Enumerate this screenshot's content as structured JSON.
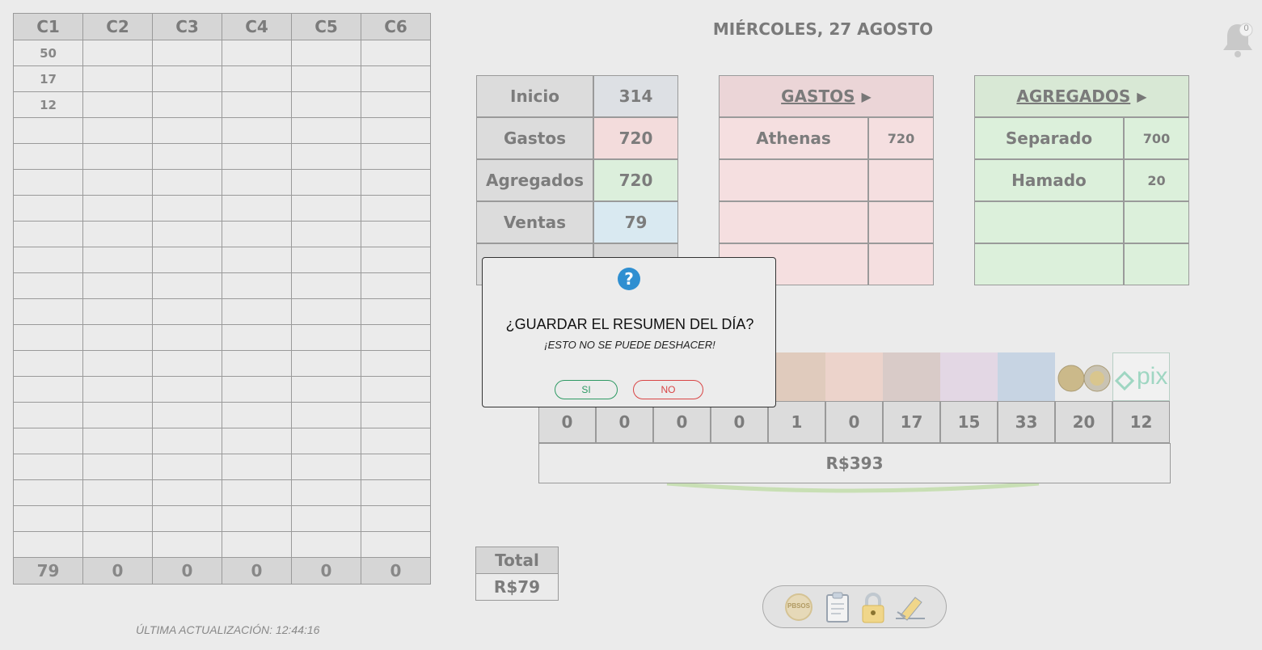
{
  "grid": {
    "headers": [
      "C1",
      "C2",
      "C3",
      "C4",
      "C5",
      "C6"
    ],
    "rows": [
      [
        "50",
        "",
        "",
        "",
        "",
        ""
      ],
      [
        "17",
        "",
        "",
        "",
        "",
        ""
      ],
      [
        "12",
        "",
        "",
        "",
        "",
        ""
      ],
      [
        "",
        "",
        "",
        "",
        "",
        ""
      ],
      [
        "",
        "",
        "",
        "",
        "",
        ""
      ],
      [
        "",
        "",
        "",
        "",
        "",
        ""
      ],
      [
        "",
        "",
        "",
        "",
        "",
        ""
      ],
      [
        "",
        "",
        "",
        "",
        "",
        ""
      ],
      [
        "",
        "",
        "",
        "",
        "",
        ""
      ],
      [
        "",
        "",
        "",
        "",
        "",
        ""
      ],
      [
        "",
        "",
        "",
        "",
        "",
        ""
      ],
      [
        "",
        "",
        "",
        "",
        "",
        ""
      ],
      [
        "",
        "",
        "",
        "",
        "",
        ""
      ],
      [
        "",
        "",
        "",
        "",
        "",
        ""
      ],
      [
        "",
        "",
        "",
        "",
        "",
        ""
      ],
      [
        "",
        "",
        "",
        "",
        "",
        ""
      ],
      [
        "",
        "",
        "",
        "",
        "",
        ""
      ],
      [
        "",
        "",
        "",
        "",
        "",
        ""
      ],
      [
        "",
        "",
        "",
        "",
        "",
        ""
      ],
      [
        "",
        "",
        "",
        "",
        "",
        ""
      ]
    ],
    "totals": [
      "79",
      "0",
      "0",
      "0",
      "0",
      "0"
    ]
  },
  "date": "MIÉRCOLES, 27 AGOSTO",
  "notifications": {
    "count": "0"
  },
  "summary": [
    {
      "label": "Inicio",
      "value": "314",
      "color": "#dde0e4"
    },
    {
      "label": "Gastos",
      "value": "720",
      "color": "#f3dcdc"
    },
    {
      "label": "Agregados",
      "value": "720",
      "color": "#dcefdc"
    },
    {
      "label": "Ventas",
      "value": "79",
      "color": "#d9e9f1"
    },
    {
      "label": "",
      "value": "",
      "color": "#d6d6d6"
    }
  ],
  "gastos": {
    "title": "GASTOS",
    "items": [
      {
        "name": "Athenas",
        "amount": "720"
      },
      {
        "name": "",
        "amount": ""
      },
      {
        "name": "",
        "amount": ""
      },
      {
        "name": "",
        "amount": ""
      }
    ],
    "colors": {
      "header": "#ebd5d7",
      "body": "#f5dfe0"
    }
  },
  "agregados": {
    "title": "AGREGADOS",
    "items": [
      {
        "name": "Separado",
        "amount": "700"
      },
      {
        "name": "Hamado",
        "amount": "20"
      },
      {
        "name": "",
        "amount": ""
      },
      {
        "name": "",
        "amount": ""
      }
    ],
    "colors": {
      "header": "#d8e8d5",
      "body": "#dcf0db"
    }
  },
  "money": {
    "counts": [
      "0",
      "0",
      "0",
      "0",
      "1",
      "0",
      "17",
      "15",
      "33",
      "20",
      "12"
    ],
    "total": "R$393",
    "pix_label": "pix"
  },
  "dialog": {
    "title": "¿GUARDAR EL RESUMEN DEL DÍA?",
    "subtitle": "¡ESTO NO SE PUEDE DESHACER!",
    "yes": "SI",
    "no": "NO"
  },
  "total": {
    "label": "Total",
    "value": "R$79"
  },
  "updated": "ÚLTIMA ACTUALIZACIÓN: 12:44:16",
  "toolbar": {
    "logo_text": "PBSOS"
  }
}
